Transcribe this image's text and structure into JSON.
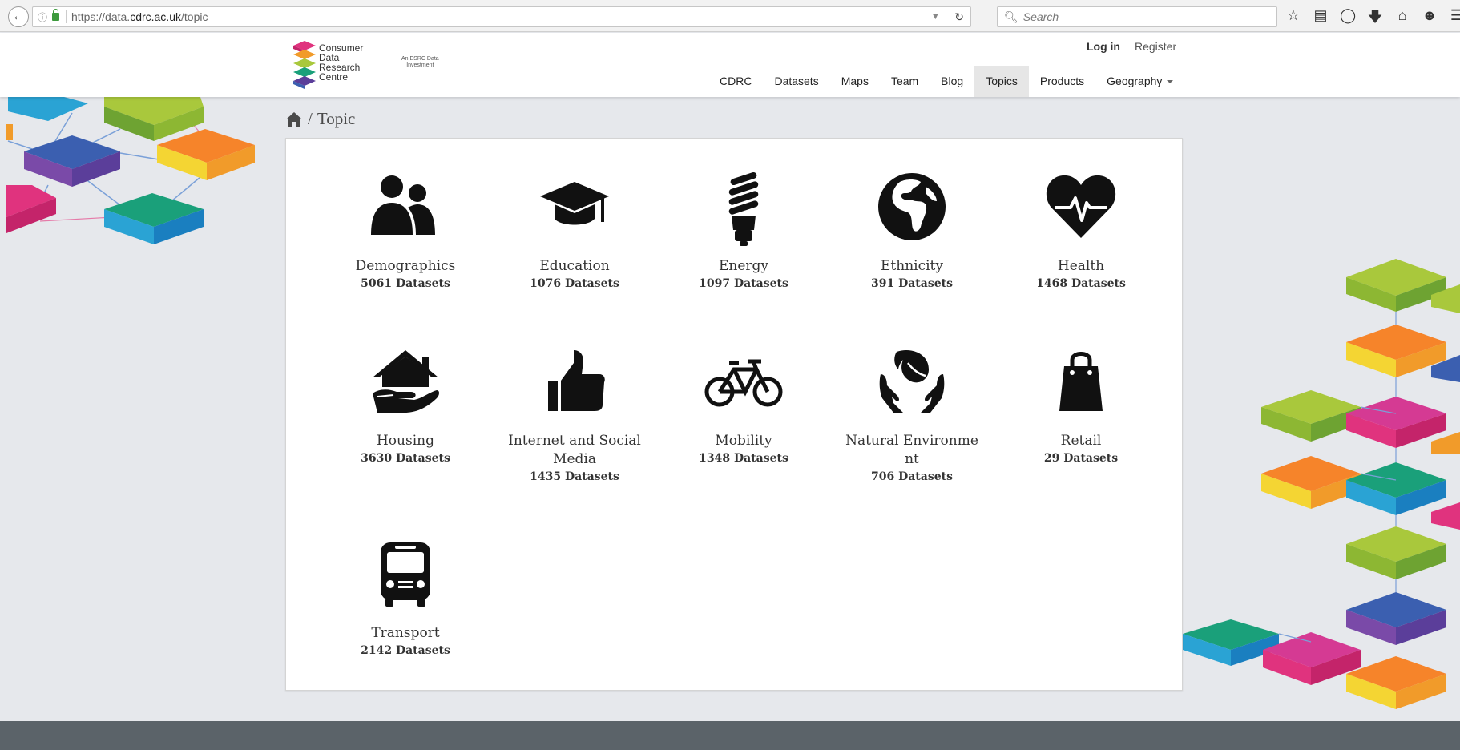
{
  "browser": {
    "url_prefix": "https://data.",
    "url_domain": "cdrc.ac.uk",
    "url_path": "/topic",
    "search_placeholder": "Search"
  },
  "logo": {
    "line1": "Consumer",
    "line2": "Data",
    "line3": "Research",
    "line4": "Centre",
    "esrc_line1": "An ESRC Data",
    "esrc_line2": "Investment"
  },
  "auth": {
    "login": "Log in",
    "register": "Register"
  },
  "nav": {
    "items": [
      {
        "label": "CDRC"
      },
      {
        "label": "Datasets"
      },
      {
        "label": "Maps"
      },
      {
        "label": "Team"
      },
      {
        "label": "Blog"
      },
      {
        "label": "Topics"
      },
      {
        "label": "Products"
      },
      {
        "label": "Geography"
      }
    ]
  },
  "breadcrumb": {
    "separator": "/",
    "current": "Topic"
  },
  "topics": [
    {
      "name": "Demographics",
      "count": "5061 Datasets",
      "icon": "people-icon"
    },
    {
      "name": "Education",
      "count": "1076 Datasets",
      "icon": "graduation-cap-icon"
    },
    {
      "name": "Energy",
      "count": "1097 Datasets",
      "icon": "energy-bulb-icon"
    },
    {
      "name": "Ethnicity",
      "count": "391 Datasets",
      "icon": "globe-icon"
    },
    {
      "name": "Health",
      "count": "1468 Datasets",
      "icon": "heartbeat-icon"
    },
    {
      "name": "Housing",
      "count": "3630 Datasets",
      "icon": "house-hand-icon"
    },
    {
      "name": "Internet and Social Media",
      "count": "1435 Datasets",
      "icon": "thumbs-up-icon"
    },
    {
      "name": "Mobility",
      "count": "1348 Datasets",
      "icon": "bicycle-icon"
    },
    {
      "name": "Natural Environme nt",
      "count": "706 Datasets",
      "icon": "leaf-hands-icon"
    },
    {
      "name": "Retail",
      "count": "29 Datasets",
      "icon": "shopping-bag-icon"
    },
    {
      "name": "Transport",
      "count": "2142 Datasets",
      "icon": "bus-icon"
    }
  ]
}
